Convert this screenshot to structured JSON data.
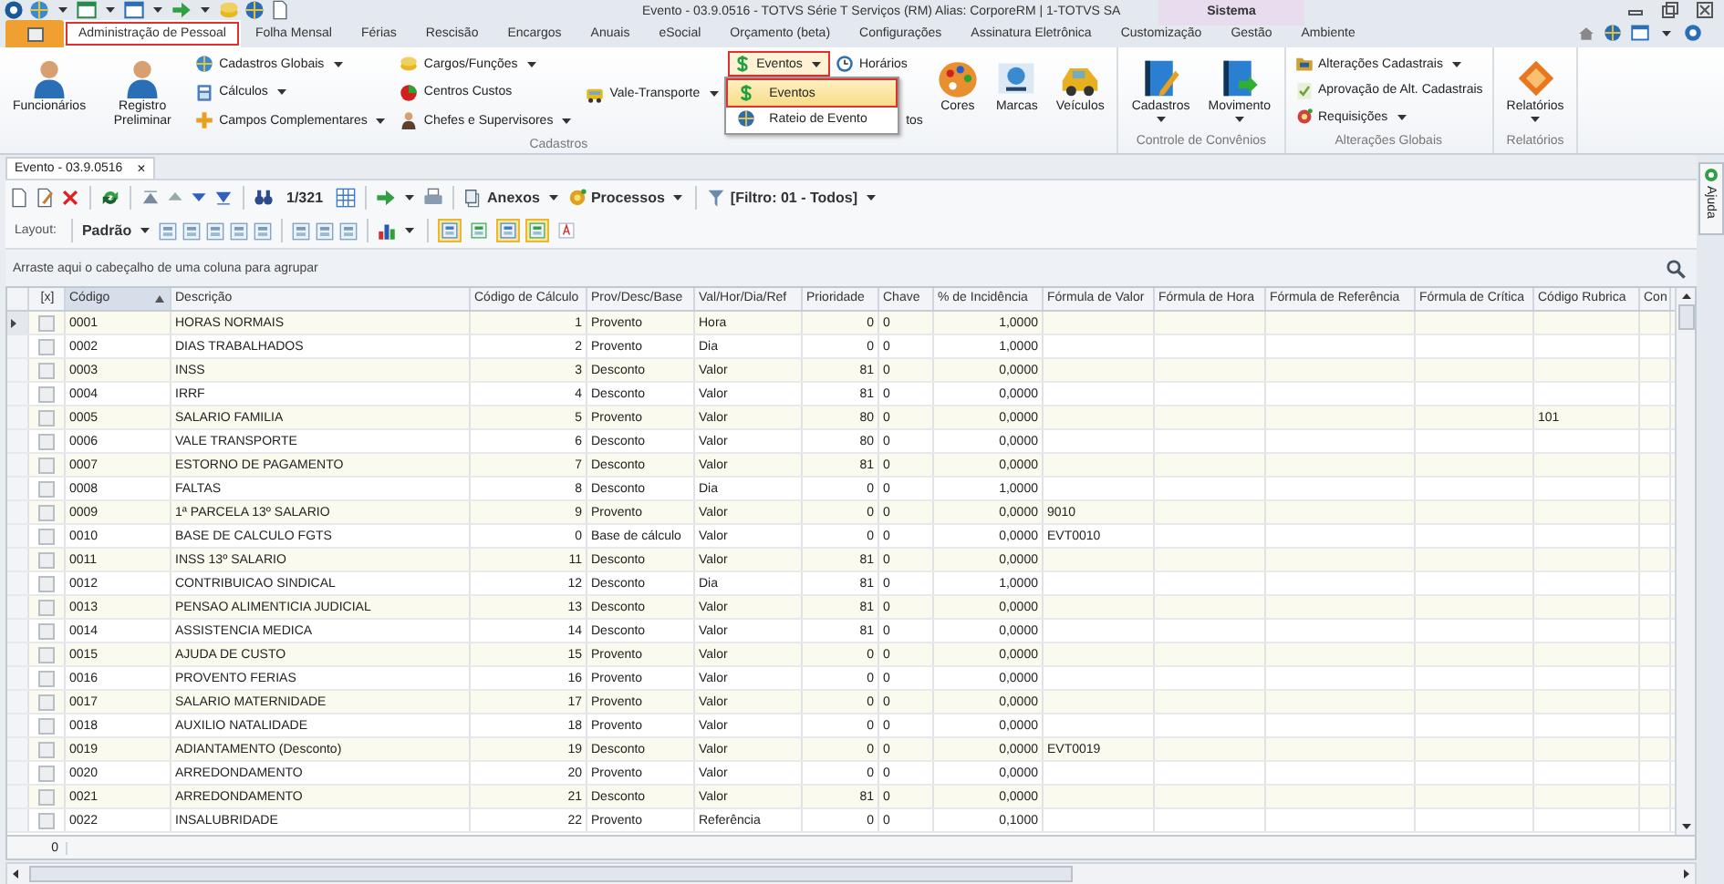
{
  "window": {
    "title": "Evento - 03.9.0516 - TOTVS Série T Serviços (RM) Alias: CorporeRM | 1-TOTVS SA",
    "context_tab": "Sistema"
  },
  "menu_tabs": [
    {
      "label": "Administração de Pessoal",
      "selected": true
    },
    {
      "label": "Folha Mensal",
      "selected": false
    },
    {
      "label": "Férias",
      "selected": false
    },
    {
      "label": "Rescisão",
      "selected": false
    },
    {
      "label": "Encargos",
      "selected": false
    },
    {
      "label": "Anuais",
      "selected": false
    },
    {
      "label": "eSocial",
      "selected": false
    },
    {
      "label": "Orçamento (beta)",
      "selected": false
    },
    {
      "label": "Configurações",
      "selected": false
    },
    {
      "label": "Assinatura Eletrônica",
      "selected": false
    },
    {
      "label": "Customização",
      "selected": false
    },
    {
      "label": "Gestão",
      "selected": false
    },
    {
      "label": "Ambiente",
      "selected": false
    }
  ],
  "ribbon": {
    "groups": [
      {
        "label": "Cadastros",
        "columns": [
          {
            "kind": "large",
            "items": [
              {
                "label": "Funcionários",
                "dropdown": false,
                "pressed": false
              }
            ]
          },
          {
            "kind": "large",
            "items": [
              {
                "label": "Registro Preliminar",
                "dropdown": false,
                "pressed": false
              }
            ]
          },
          {
            "kind": "stack",
            "items": [
              {
                "label": "Cadastros Globais",
                "dropdown": true,
                "pressed": false
              },
              {
                "label": "Cálculos",
                "dropdown": true,
                "pressed": false
              },
              {
                "label": "Campos Complementares",
                "dropdown": true,
                "pressed": false
              }
            ]
          },
          {
            "kind": "stack",
            "items": [
              {
                "label": "Cargos/Funções",
                "dropdown": true,
                "pressed": false
              },
              {
                "label": "Centros Custos",
                "dropdown": false,
                "pressed": false
              },
              {
                "label": "Chefes e Supervisores",
                "dropdown": true,
                "pressed": false
              }
            ]
          },
          {
            "kind": "middle",
            "items": [
              {
                "label": "Vale-Transporte",
                "dropdown": true,
                "pressed": false
              }
            ]
          },
          {
            "kind": "stack",
            "items": [
              {
                "label": "Eventos",
                "dropdown": true,
                "pressed": true
              }
            ]
          },
          {
            "kind": "stack",
            "items": [
              {
                "label": "Horários",
                "dropdown": false,
                "pressed": false
              },
              {
                "label": "tos",
                "dropdown": false,
                "pressed": false
              }
            ]
          },
          {
            "kind": "large",
            "items": [
              {
                "label": "Cores",
                "dropdown": false,
                "pressed": false
              }
            ]
          },
          {
            "kind": "large",
            "items": [
              {
                "label": "Marcas",
                "dropdown": false,
                "pressed": false
              }
            ]
          },
          {
            "kind": "large",
            "items": [
              {
                "label": "Veículos",
                "dropdown": false,
                "pressed": false
              }
            ]
          }
        ]
      },
      {
        "label": "Controle de Convênios",
        "columns": [
          {
            "kind": "large",
            "items": [
              {
                "label": "Cadastros",
                "dropdown": true,
                "pressed": false
              }
            ]
          },
          {
            "kind": "large",
            "items": [
              {
                "label": "Movimento",
                "dropdown": true,
                "pressed": false
              }
            ]
          }
        ]
      },
      {
        "label": "Alterações Globais",
        "columns": [
          {
            "kind": "stack",
            "items": [
              {
                "label": "Alterações Cadastrais",
                "dropdown": true,
                "pressed": false
              },
              {
                "label": "Aprovação de Alt. Cadastrais",
                "dropdown": false,
                "pressed": false
              },
              {
                "label": "Requisições",
                "dropdown": true,
                "pressed": false
              }
            ]
          }
        ]
      },
      {
        "label": "Relatórios",
        "columns": [
          {
            "kind": "large",
            "items": [
              {
                "label": "Relatórios",
                "dropdown": true,
                "pressed": false
              }
            ]
          }
        ]
      }
    ]
  },
  "dropdown_menu": {
    "items": [
      {
        "label": "Eventos",
        "selected": true
      },
      {
        "label": "Rateio de Evento",
        "selected": false
      }
    ]
  },
  "document_tab": {
    "label": "Evento - 03.9.0516",
    "close": "×"
  },
  "toolbar": {
    "record_position": "1/321",
    "attachments": "Anexos",
    "processes": "Processos",
    "filter": "[Filtro: 01 - Todos]"
  },
  "layout_bar": {
    "label": "Layout:",
    "preset": "Padrão",
    "view_toggles": [
      {
        "on": true
      },
      {
        "on": false
      },
      {
        "on": true
      },
      {
        "on": true
      },
      {
        "on": false
      }
    ]
  },
  "group_panel": {
    "hint": "Arraste aqui o cabeçalho de uma coluna para agrupar"
  },
  "side_panel": {
    "label": "Ajuda"
  },
  "table": {
    "check_header": "[x]",
    "columns": [
      {
        "label": "Código",
        "sorted": true
      },
      {
        "label": "Descrição",
        "sorted": false
      },
      {
        "label": "Código de Cálculo",
        "sorted": false
      },
      {
        "label": "Prov/Desc/Base",
        "sorted": false
      },
      {
        "label": "Val/Hor/Dia/Ref",
        "sorted": false
      },
      {
        "label": "Prioridade",
        "sorted": false
      },
      {
        "label": "Chave",
        "sorted": false
      },
      {
        "label": "% de Incidência",
        "sorted": false
      },
      {
        "label": "Fórmula de Valor",
        "sorted": false
      },
      {
        "label": "Fórmula de Hora",
        "sorted": false
      },
      {
        "label": "Fórmula de Referência",
        "sorted": false
      },
      {
        "label": "Fórmula de Crítica",
        "sorted": false
      },
      {
        "label": "Código Rubrica",
        "sorted": false
      },
      {
        "label": "Con",
        "sorted": false
      }
    ],
    "rows": [
      {
        "selected": true,
        "checked": false,
        "codigo": "0001",
        "descricao": "HORAS NORMAIS",
        "codigo_calculo": "1",
        "prov_desc_base": "Provento",
        "val_hor_dia_ref": "Hora",
        "prioridade": "0",
        "chave": "0",
        "incidencia": "1,0000"
      },
      {
        "selected": false,
        "checked": false,
        "codigo": "0002",
        "descricao": "DIAS TRABALHADOS",
        "codigo_calculo": "2",
        "prov_desc_base": "Provento",
        "val_hor_dia_ref": "Dia",
        "prioridade": "0",
        "chave": "0",
        "incidencia": "1,0000"
      },
      {
        "selected": false,
        "checked": false,
        "codigo": "0003",
        "descricao": "INSS",
        "codigo_calculo": "3",
        "prov_desc_base": "Desconto",
        "val_hor_dia_ref": "Valor",
        "prioridade": "81",
        "chave": "0",
        "incidencia": "0,0000"
      },
      {
        "selected": false,
        "checked": false,
        "codigo": "0004",
        "descricao": "IRRF",
        "codigo_calculo": "4",
        "prov_desc_base": "Desconto",
        "val_hor_dia_ref": "Valor",
        "prioridade": "81",
        "chave": "0",
        "incidencia": "0,0000"
      },
      {
        "selected": false,
        "checked": false,
        "codigo": "0005",
        "descricao": "SALARIO FAMILIA",
        "codigo_calculo": "5",
        "prov_desc_base": "Provento",
        "val_hor_dia_ref": "Valor",
        "prioridade": "80",
        "chave": "0",
        "incidencia": "0,0000",
        "codigo_rubrica": "101"
      },
      {
        "selected": false,
        "checked": false,
        "codigo": "0006",
        "descricao": "VALE TRANSPORTE",
        "codigo_calculo": "6",
        "prov_desc_base": "Desconto",
        "val_hor_dia_ref": "Valor",
        "prioridade": "80",
        "chave": "0",
        "incidencia": "0,0000"
      },
      {
        "selected": false,
        "checked": false,
        "codigo": "0007",
        "descricao": "ESTORNO DE PAGAMENTO",
        "codigo_calculo": "7",
        "prov_desc_base": "Desconto",
        "val_hor_dia_ref": "Valor",
        "prioridade": "81",
        "chave": "0",
        "incidencia": "0,0000"
      },
      {
        "selected": false,
        "checked": false,
        "codigo": "0008",
        "descricao": "FALTAS",
        "codigo_calculo": "8",
        "prov_desc_base": "Desconto",
        "val_hor_dia_ref": "Dia",
        "prioridade": "0",
        "chave": "0",
        "incidencia": "1,0000"
      },
      {
        "selected": false,
        "checked": false,
        "codigo": "0009",
        "descricao": "1ª PARCELA 13º SALARIO",
        "codigo_calculo": "9",
        "prov_desc_base": "Provento",
        "val_hor_dia_ref": "Valor",
        "prioridade": "0",
        "chave": "0",
        "incidencia": "0,0000",
        "formula_valor": "9010"
      },
      {
        "selected": false,
        "checked": false,
        "codigo": "0010",
        "descricao": "BASE DE CALCULO FGTS",
        "codigo_calculo": "0",
        "prov_desc_base": "Base de cálculo",
        "val_hor_dia_ref": "Valor",
        "prioridade": "0",
        "chave": "0",
        "incidencia": "0,0000",
        "formula_valor": "EVT0010"
      },
      {
        "selected": false,
        "checked": false,
        "codigo": "0011",
        "descricao": "INSS 13º SALARIO",
        "codigo_calculo": "11",
        "prov_desc_base": "Desconto",
        "val_hor_dia_ref": "Valor",
        "prioridade": "81",
        "chave": "0",
        "incidencia": "0,0000"
      },
      {
        "selected": false,
        "checked": false,
        "codigo": "0012",
        "descricao": "CONTRIBUICAO SINDICAL",
        "codigo_calculo": "12",
        "prov_desc_base": "Desconto",
        "val_hor_dia_ref": "Dia",
        "prioridade": "81",
        "chave": "0",
        "incidencia": "1,0000"
      },
      {
        "selected": false,
        "checked": false,
        "codigo": "0013",
        "descricao": "PENSAO ALIMENTICIA JUDICIAL",
        "codigo_calculo": "13",
        "prov_desc_base": "Desconto",
        "val_hor_dia_ref": "Valor",
        "prioridade": "81",
        "chave": "0",
        "incidencia": "0,0000"
      },
      {
        "selected": false,
        "checked": false,
        "codigo": "0014",
        "descricao": "ASSISTENCIA MEDICA",
        "codigo_calculo": "14",
        "prov_desc_base": "Desconto",
        "val_hor_dia_ref": "Valor",
        "prioridade": "81",
        "chave": "0",
        "incidencia": "0,0000"
      },
      {
        "selected": false,
        "checked": false,
        "codigo": "0015",
        "descricao": "AJUDA DE CUSTO",
        "codigo_calculo": "15",
        "prov_desc_base": "Provento",
        "val_hor_dia_ref": "Valor",
        "prioridade": "0",
        "chave": "0",
        "incidencia": "0,0000"
      },
      {
        "selected": false,
        "checked": false,
        "codigo": "0016",
        "descricao": "PROVENTO FERIAS",
        "codigo_calculo": "16",
        "prov_desc_base": "Provento",
        "val_hor_dia_ref": "Valor",
        "prioridade": "0",
        "chave": "0",
        "incidencia": "0,0000"
      },
      {
        "selected": false,
        "checked": false,
        "codigo": "0017",
        "descricao": "SALARIO MATERNIDADE",
        "codigo_calculo": "17",
        "prov_desc_base": "Provento",
        "val_hor_dia_ref": "Valor",
        "prioridade": "0",
        "chave": "0",
        "incidencia": "0,0000"
      },
      {
        "selected": false,
        "checked": false,
        "codigo": "0018",
        "descricao": "AUXILIO NATALIDADE",
        "codigo_calculo": "18",
        "prov_desc_base": "Provento",
        "val_hor_dia_ref": "Valor",
        "prioridade": "0",
        "chave": "0",
        "incidencia": "0,0000"
      },
      {
        "selected": false,
        "checked": false,
        "codigo": "0019",
        "descricao": "ADIANTAMENTO (Desconto)",
        "codigo_calculo": "19",
        "prov_desc_base": "Desconto",
        "val_hor_dia_ref": "Valor",
        "prioridade": "0",
        "chave": "0",
        "incidencia": "0,0000",
        "formula_valor": "EVT0019"
      },
      {
        "selected": false,
        "checked": false,
        "codigo": "0020",
        "descricao": "ARREDONDAMENTO",
        "codigo_calculo": "20",
        "prov_desc_base": "Provento",
        "val_hor_dia_ref": "Valor",
        "prioridade": "0",
        "chave": "0",
        "incidencia": "0,0000"
      },
      {
        "selected": false,
        "checked": false,
        "codigo": "0021",
        "descricao": "ARREDONDAMENTO",
        "codigo_calculo": "21",
        "prov_desc_base": "Desconto",
        "val_hor_dia_ref": "Valor",
        "prioridade": "81",
        "chave": "0",
        "incidencia": "0,0000"
      },
      {
        "selected": false,
        "checked": false,
        "codigo": "0022",
        "descricao": "INSALUBRIDADE",
        "codigo_calculo": "22",
        "prov_desc_base": "Provento",
        "val_hor_dia_ref": "Referência",
        "prioridade": "0",
        "chave": "0",
        "incidencia": "0,1000"
      }
    ]
  },
  "footer": {
    "summary": "0"
  }
}
